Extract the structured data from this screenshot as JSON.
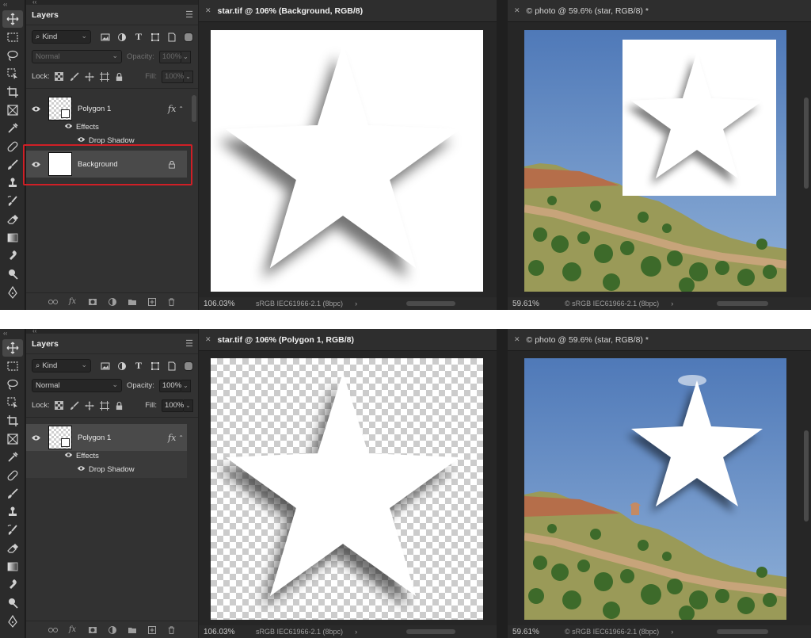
{
  "top": {
    "layers_panel": {
      "tab": "Layers",
      "kind_label": "Kind",
      "blend_mode": "Normal",
      "opacity_label": "Opacity:",
      "opacity_value": "100%",
      "lock_label": "Lock:",
      "fill_label": "Fill:",
      "fill_value": "100%",
      "layers": [
        {
          "name": "Polygon 1",
          "effects_label": "Effects",
          "effect_name": "Drop Shadow"
        },
        {
          "name": "Background"
        }
      ]
    },
    "doc_left": {
      "title": "star.tif @ 106% (Background, RGB/8)",
      "zoom": "106.03%",
      "profile": "sRGB IEC61966-2.1 (8bpc)"
    },
    "doc_right": {
      "title": "© photo @ 59.6% (star, RGB/8) *",
      "zoom": "59.61%",
      "profile": "© sRGB IEC61966-2.1 (8bpc)"
    }
  },
  "bottom": {
    "layers_panel": {
      "tab": "Layers",
      "kind_label": "Kind",
      "blend_mode": "Normal",
      "opacity_label": "Opacity:",
      "opacity_value": "100%",
      "lock_label": "Lock:",
      "fill_label": "Fill:",
      "fill_value": "100%",
      "layers": [
        {
          "name": "Polygon 1",
          "effects_label": "Effects",
          "effect_name": "Drop Shadow"
        }
      ]
    },
    "doc_left": {
      "title": "star.tif @ 106% (Polygon 1, RGB/8)",
      "zoom": "106.03%",
      "profile": "sRGB IEC61966-2.1 (8bpc)"
    },
    "doc_right": {
      "title": "© photo @ 59.6% (star, RGB/8) *",
      "zoom": "59.61%",
      "profile": "© sRGB IEC61966-2.1 (8bpc)"
    }
  },
  "colors": {
    "highlight_border": "#d01f26",
    "panel_bg": "#323232",
    "app_bg": "#1f1f1f",
    "sky": "#5b86bf"
  },
  "tools": [
    "move-icon",
    "marquee-icon",
    "lasso-icon",
    "object-select-icon",
    "crop-icon",
    "frame-icon",
    "eyedropper-icon",
    "healing-icon",
    "brush-icon",
    "stamp-icon",
    "history-brush-icon",
    "eraser-icon",
    "gradient-icon",
    "smudge-icon",
    "dodge-icon",
    "pen-icon"
  ]
}
